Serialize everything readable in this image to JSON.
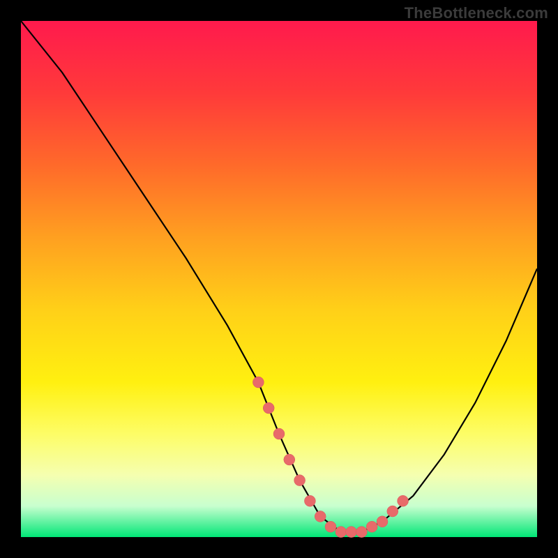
{
  "watermark": "TheBottleneck.com",
  "chart_data": {
    "type": "line",
    "title": "",
    "xlabel": "",
    "ylabel": "",
    "xlim": [
      0,
      100
    ],
    "ylim": [
      0,
      100
    ],
    "series": [
      {
        "name": "bottleneck-curve",
        "x": [
          0,
          8,
          16,
          24,
          32,
          40,
          46,
          50,
          54,
          58,
          62,
          66,
          70,
          76,
          82,
          88,
          94,
          100
        ],
        "values": [
          100,
          90,
          78,
          66,
          54,
          41,
          30,
          20,
          11,
          4,
          1,
          1,
          3,
          8,
          16,
          26,
          38,
          52
        ]
      }
    ],
    "markers": {
      "name": "highlighted-points",
      "x": [
        46,
        48,
        50,
        52,
        54,
        56,
        58,
        60,
        62,
        64,
        66,
        68,
        70,
        72,
        74
      ],
      "values": [
        30,
        25,
        20,
        15,
        11,
        7,
        4,
        2,
        1,
        1,
        1,
        2,
        3,
        5,
        7
      ]
    }
  }
}
